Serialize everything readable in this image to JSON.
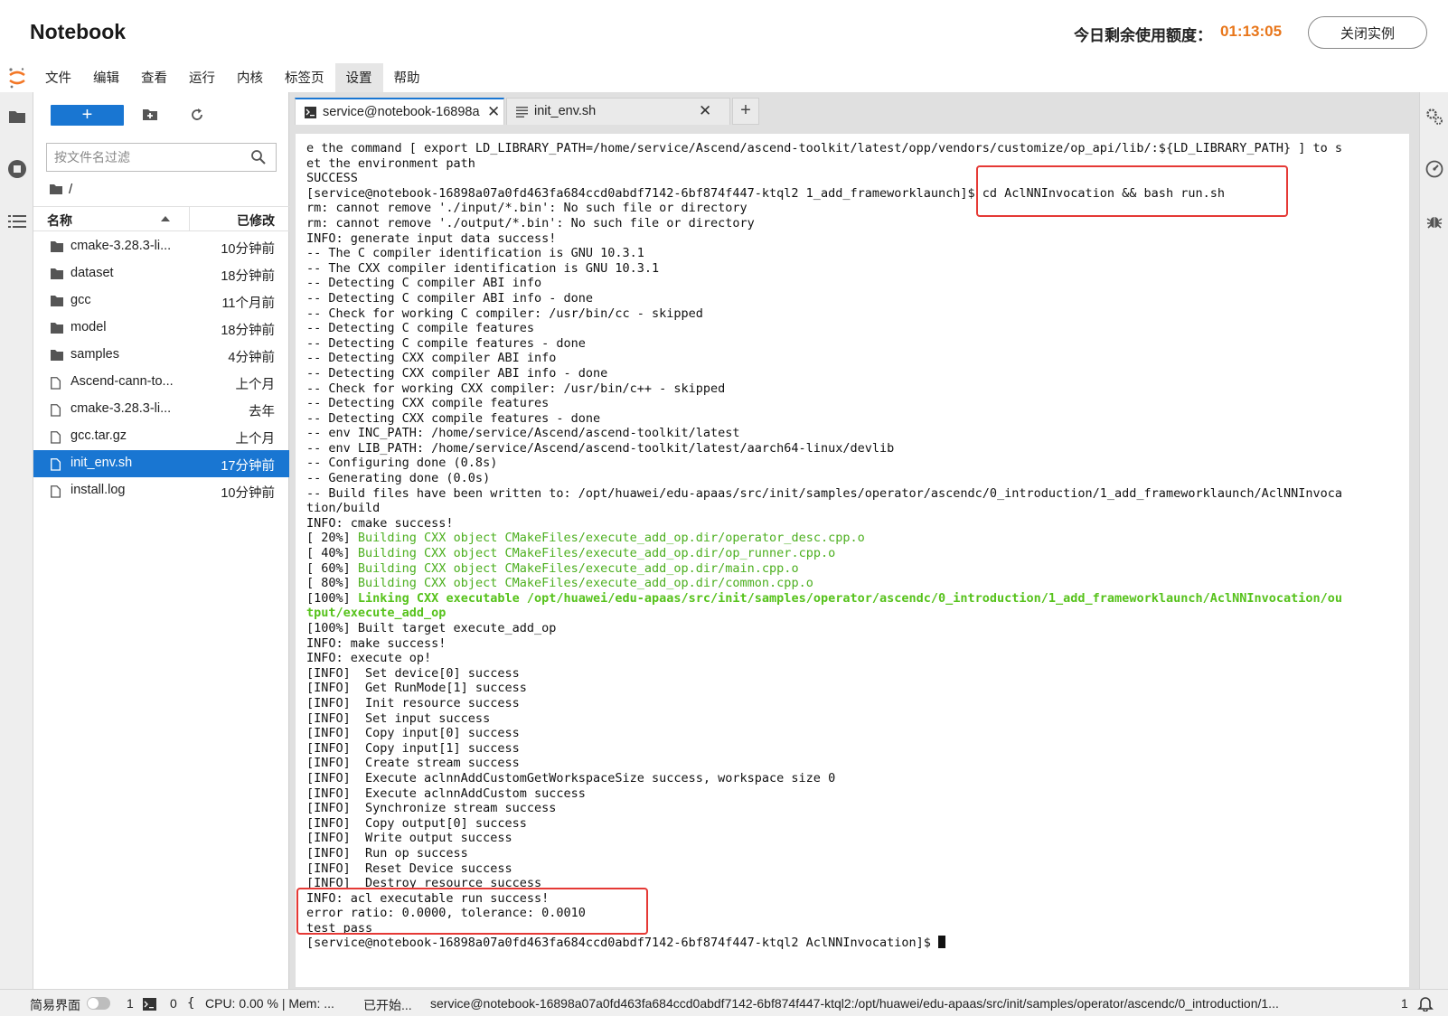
{
  "header": {
    "app_title": "Notebook",
    "quota_label": "今日剩余使用额度：",
    "quota_time": "01:13:05",
    "close_button": "关闭实例"
  },
  "menu": [
    "文件",
    "编辑",
    "查看",
    "运行",
    "内核",
    "标签页",
    "设置",
    "帮助"
  ],
  "filebrowser": {
    "new_button": "+",
    "filter_placeholder": "按文件名过滤",
    "breadcrumb": "/",
    "col_name": "名称",
    "col_modified": "已修改",
    "files": [
      {
        "name": "cmake-3.28.3-li...",
        "modified": "10分钟前",
        "type": "folder"
      },
      {
        "name": "dataset",
        "modified": "18分钟前",
        "type": "folder"
      },
      {
        "name": "gcc",
        "modified": "11个月前",
        "type": "folder"
      },
      {
        "name": "model",
        "modified": "18分钟前",
        "type": "folder"
      },
      {
        "name": "samples",
        "modified": "4分钟前",
        "type": "folder"
      },
      {
        "name": "Ascend-cann-to...",
        "modified": "上个月",
        "type": "file"
      },
      {
        "name": "cmake-3.28.3-li...",
        "modified": "去年",
        "type": "file"
      },
      {
        "name": "gcc.tar.gz",
        "modified": "上个月",
        "type": "file"
      },
      {
        "name": "init_env.sh",
        "modified": "17分钟前",
        "type": "file",
        "selected": true
      },
      {
        "name": "install.log",
        "modified": "10分钟前",
        "type": "file"
      }
    ]
  },
  "tabs": [
    {
      "label": "service@notebook-16898a",
      "icon": "terminal-icon",
      "active": true
    },
    {
      "label": "init_env.sh",
      "icon": "text-file-icon",
      "active": false
    }
  ],
  "terminal": {
    "lines": [
      {
        "t": "e the command [ export LD_LIBRARY_PATH=/home/service/Ascend/ascend-toolkit/latest/opp/vendors/customize/op_api/lib/:${LD_LIBRARY_PATH} ] to s"
      },
      {
        "t": "et the environment path"
      },
      {
        "t": "SUCCESS"
      },
      {
        "t": "[service@notebook-16898a07a0fd463fa684ccd0abdf7142-6bf874f447-ktql2 1_add_frameworklaunch]$ cd AclNNInvocation && bash run.sh"
      },
      {
        "t": "rm: cannot remove './input/*.bin': No such file or directory"
      },
      {
        "t": "rm: cannot remove './output/*.bin': No such file or directory"
      },
      {
        "t": "INFO: generate input data success!"
      },
      {
        "t": "-- The C compiler identification is GNU 10.3.1"
      },
      {
        "t": "-- The CXX compiler identification is GNU 10.3.1"
      },
      {
        "t": "-- Detecting C compiler ABI info"
      },
      {
        "t": "-- Detecting C compiler ABI info - done"
      },
      {
        "t": "-- Check for working C compiler: /usr/bin/cc - skipped"
      },
      {
        "t": "-- Detecting C compile features"
      },
      {
        "t": "-- Detecting C compile features - done"
      },
      {
        "t": "-- Detecting CXX compiler ABI info"
      },
      {
        "t": "-- Detecting CXX compiler ABI info - done"
      },
      {
        "t": "-- Check for working CXX compiler: /usr/bin/c++ - skipped"
      },
      {
        "t": "-- Detecting CXX compile features"
      },
      {
        "t": "-- Detecting CXX compile features - done"
      },
      {
        "t": "-- env INC_PATH: /home/service/Ascend/ascend-toolkit/latest"
      },
      {
        "t": "-- env LIB_PATH: /home/service/Ascend/ascend-toolkit/latest/aarch64-linux/devlib"
      },
      {
        "t": "-- Configuring done (0.8s)"
      },
      {
        "t": "-- Generating done (0.0s)"
      },
      {
        "t": "-- Build files have been written to: /opt/huawei/edu-apaas/src/init/samples/operator/ascendc/0_introduction/1_add_frameworklaunch/AclNNInvoca"
      },
      {
        "t": "tion/build"
      },
      {
        "t": "INFO: cmake success!"
      },
      {
        "p": "[ 20%] ",
        "g": "Building CXX object CMakeFiles/execute_add_op.dir/operator_desc.cpp.o"
      },
      {
        "p": "[ 40%] ",
        "g": "Building CXX object CMakeFiles/execute_add_op.dir/op_runner.cpp.o"
      },
      {
        "p": "[ 60%] ",
        "g": "Building CXX object CMakeFiles/execute_add_op.dir/main.cpp.o"
      },
      {
        "p": "[ 80%] ",
        "g": "Building CXX object CMakeFiles/execute_add_op.dir/common.cpp.o"
      },
      {
        "p": "[100%] ",
        "b": "Linking CXX executable /opt/huawei/edu-apaas/src/init/samples/operator/ascendc/0_introduction/1_add_frameworklaunch/AclNNInvocation/ou"
      },
      {
        "b": "tput/execute_add_op"
      },
      {
        "t": "[100%] Built target execute_add_op"
      },
      {
        "t": "INFO: make success!"
      },
      {
        "t": "INFO: execute op!"
      },
      {
        "t": "[INFO]  Set device[0] success"
      },
      {
        "t": "[INFO]  Get RunMode[1] success"
      },
      {
        "t": "[INFO]  Init resource success"
      },
      {
        "t": "[INFO]  Set input success"
      },
      {
        "t": "[INFO]  Copy input[0] success"
      },
      {
        "t": "[INFO]  Copy input[1] success"
      },
      {
        "t": "[INFO]  Create stream success"
      },
      {
        "t": "[INFO]  Execute aclnnAddCustomGetWorkspaceSize success, workspace size 0"
      },
      {
        "t": "[INFO]  Execute aclnnAddCustom success"
      },
      {
        "t": "[INFO]  Synchronize stream success"
      },
      {
        "t": "[INFO]  Copy output[0] success"
      },
      {
        "t": "[INFO]  Write output success"
      },
      {
        "t": "[INFO]  Run op success"
      },
      {
        "t": "[INFO]  Reset Device success"
      },
      {
        "t": "[INFO]  Destroy resource success"
      },
      {
        "t": "INFO: acl executable run success!"
      },
      {
        "t": "error ratio: 0.0000, tolerance: 0.0010"
      },
      {
        "t": "test pass"
      },
      {
        "t": "[service@notebook-16898a07a0fd463fa684ccd0abdf7142-6bf874f447-ktql2 AclNNInvocation]$ ",
        "cursor": true
      }
    ]
  },
  "statusbar": {
    "simple_mode": "简易界面",
    "terminals": "1",
    "kernels": "0",
    "cpu_mem": "CPU: 0.00 % | Mem: ...",
    "started": "已开始...",
    "path": "service@notebook-16898a07a0fd463fa684ccd0abdf7142-6bf874f447-ktql2:/opt/huawei/edu-apaas/src/init/samples/operator/ascendc/0_introduction/1...",
    "right_count": "1"
  },
  "colors": {
    "accent": "#1976d2",
    "quota_time": "#e8761a",
    "highlight_box": "#e53935",
    "terminal_green": "#4caf1f"
  }
}
